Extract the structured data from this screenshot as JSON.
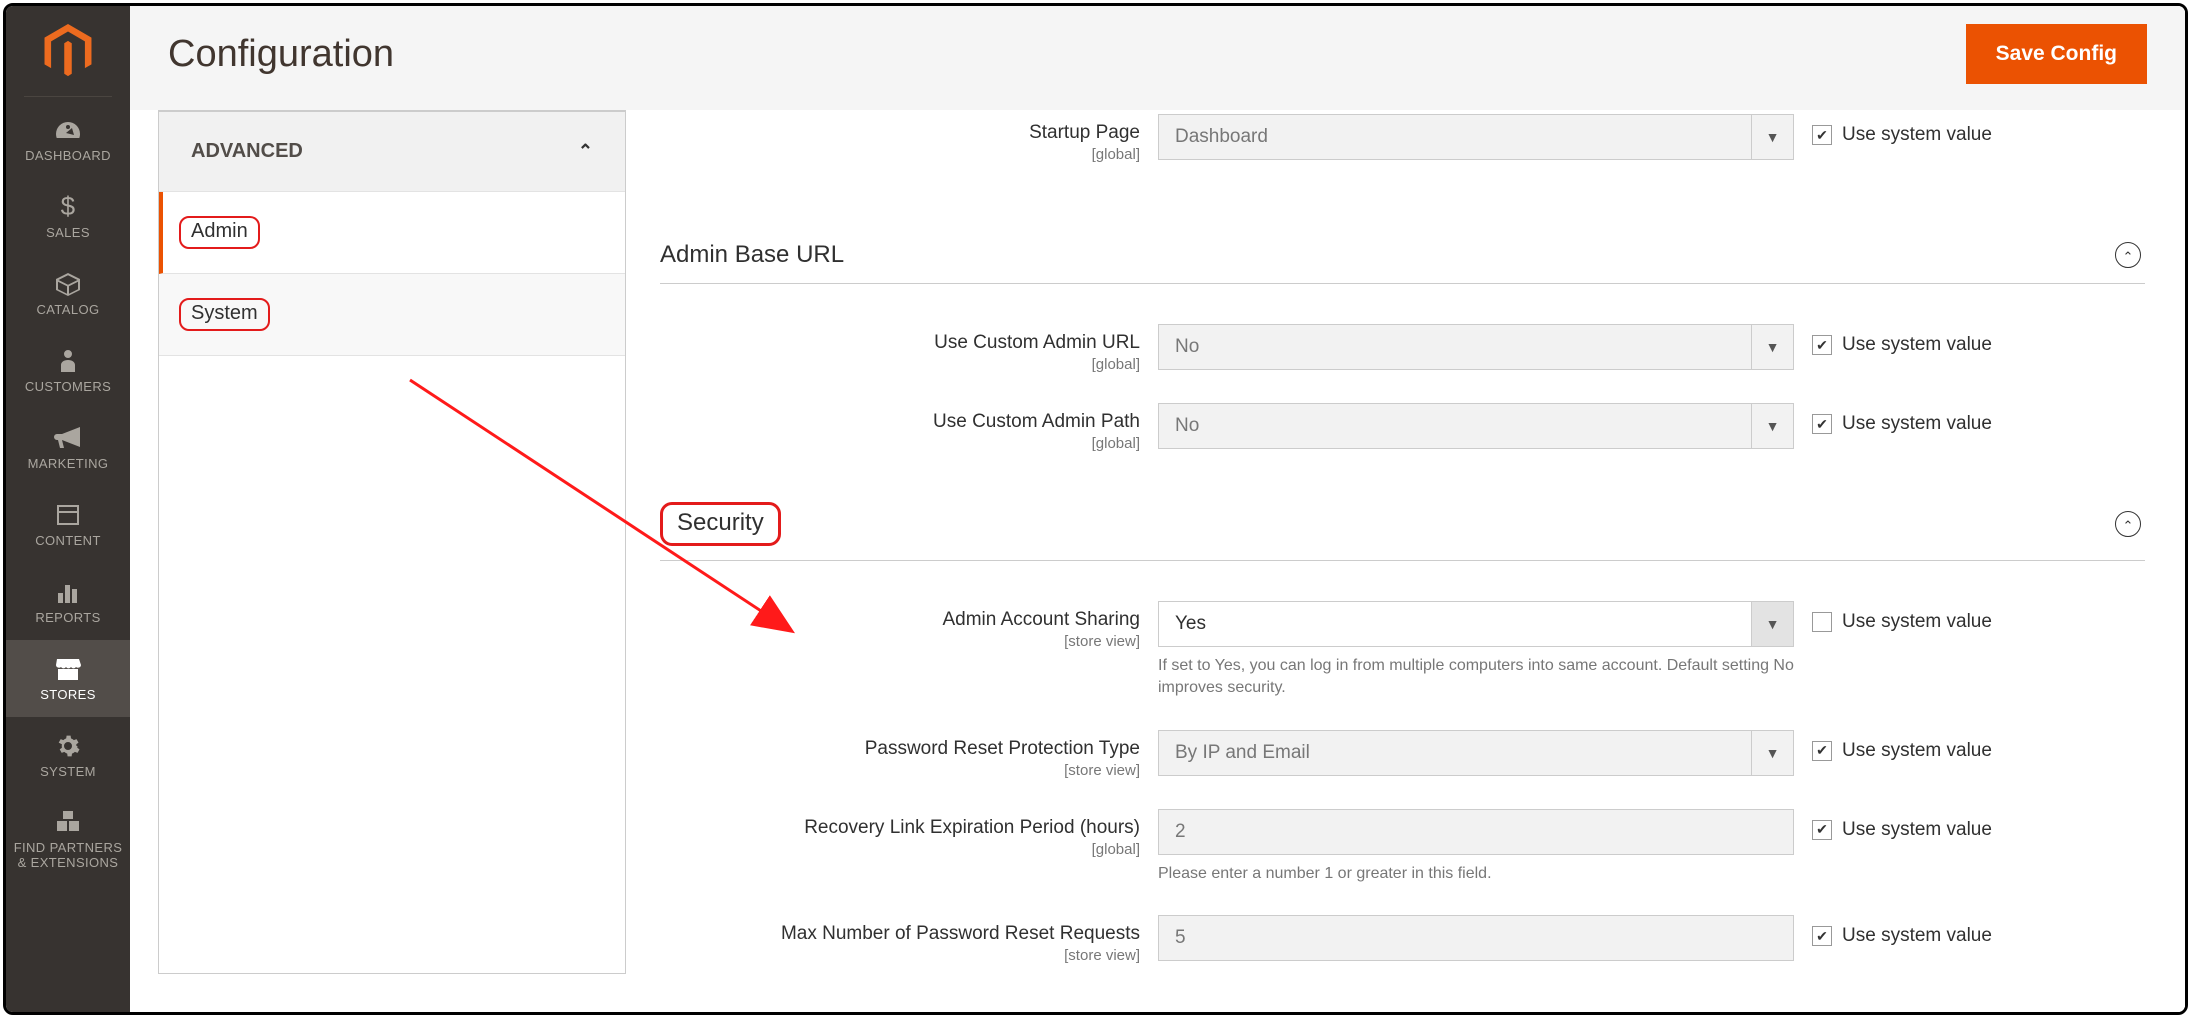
{
  "nav": {
    "items": [
      {
        "label": "DASHBOARD"
      },
      {
        "label": "SALES"
      },
      {
        "label": "CATALOG"
      },
      {
        "label": "CUSTOMERS"
      },
      {
        "label": "MARKETING"
      },
      {
        "label": "CONTENT"
      },
      {
        "label": "REPORTS"
      },
      {
        "label": "STORES"
      },
      {
        "label": "SYSTEM"
      },
      {
        "label": "FIND PARTNERS\n& EXTENSIONS"
      }
    ]
  },
  "header": {
    "title": "Configuration",
    "save": "Save Config"
  },
  "tabs": {
    "group": "ADVANCED",
    "items": [
      {
        "label": "Admin"
      },
      {
        "label": "System"
      }
    ]
  },
  "sections": {
    "startup": {
      "label": "Startup Page",
      "scope": "[global]",
      "value": "Dashboard",
      "sys": "Use system value"
    },
    "adminbase": {
      "title": "Admin Base URL",
      "f1": {
        "label": "Use Custom Admin URL",
        "scope": "[global]",
        "value": "No",
        "sys": "Use system value"
      },
      "f2": {
        "label": "Use Custom Admin Path",
        "scope": "[global]",
        "value": "No",
        "sys": "Use system value"
      }
    },
    "security": {
      "title": "Security",
      "f1": {
        "label": "Admin Account Sharing",
        "scope": "[store view]",
        "value": "Yes",
        "sys": "Use system value",
        "help": "If set to Yes, you can log in from multiple computers into same account. Default setting No improves security."
      },
      "f2": {
        "label": "Password Reset Protection Type",
        "scope": "[store view]",
        "value": "By IP and Email",
        "sys": "Use system value"
      },
      "f3": {
        "label": "Recovery Link Expiration Period (hours)",
        "scope": "[global]",
        "value": "2",
        "sys": "Use system value",
        "help": "Please enter a number 1 or greater in this field."
      },
      "f4": {
        "label": "Max Number of Password Reset Requests",
        "scope": "[store view]",
        "value": "5",
        "sys": "Use system value"
      }
    }
  }
}
